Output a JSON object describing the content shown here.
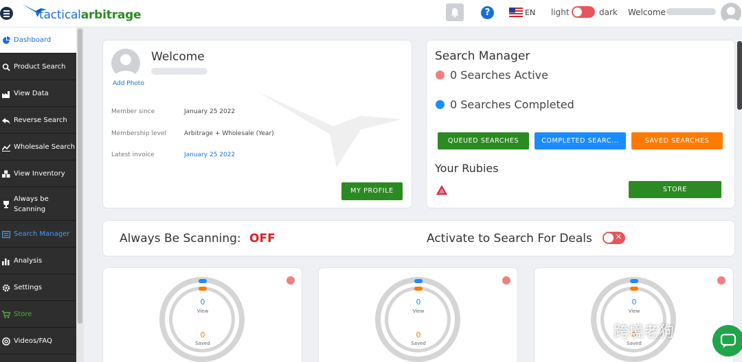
{
  "header": {
    "logo_left": "tactical",
    "logo_right": "arbitrage",
    "language": "EN",
    "theme_light": "light",
    "theme_dark": "dark",
    "welcome": "Welcome"
  },
  "sidebar": {
    "items": [
      {
        "label": "Dashboard"
      },
      {
        "label": "Product Search"
      },
      {
        "label": "View Data"
      },
      {
        "label": "Reverse Search"
      },
      {
        "label": "Wholesale Search"
      },
      {
        "label": "View Inventory"
      },
      {
        "label": "Always be Scanning"
      },
      {
        "label": "Search Manager"
      },
      {
        "label": "Analysis"
      },
      {
        "label": "Settings"
      },
      {
        "label": "Store"
      },
      {
        "label": "Videos/FAQ"
      }
    ]
  },
  "welcome_card": {
    "title": "Welcome",
    "add_photo": "Add Photo",
    "member_since_label": "Member since",
    "member_since_value": "January 25 2022",
    "membership_label": "Membership level",
    "membership_value": "Arbitrage + Wholesale (Year)",
    "invoice_label": "Latest invoice",
    "invoice_value": "January 25 2022",
    "profile_button": "MY PROFILE"
  },
  "search_manager": {
    "title": "Search Manager",
    "active": "0 Searches Active",
    "completed": "0 Searches Completed",
    "queued_button": "QUEUED SEARCHES",
    "completed_button": "COMPLETED SEARC...",
    "saved_button": "SAVED SEARCHES",
    "rubies_title": "Your Rubies",
    "store_button": "STORE"
  },
  "scanning": {
    "label": "Always Be Scanning:",
    "value": "OFF",
    "activate_label": "Activate to Search For Deals",
    "toggle_symbol": "✕"
  },
  "mini_cards": [
    {
      "view_count": "0",
      "view_label": "View",
      "saved_count": "0",
      "saved_label": "Saved"
    },
    {
      "view_count": "0",
      "view_label": "View",
      "saved_count": "0",
      "saved_label": "Saved"
    },
    {
      "view_count": "0",
      "view_label": "View",
      "saved_count": "0",
      "saved_label": "Saved"
    }
  ],
  "watermark_text": "跨境老狗",
  "colors": {
    "primary_blue": "#1a6fd6",
    "brand_green": "#2c8a22",
    "accent_orange": "#ff7a00",
    "alert_red": "#e02020",
    "sidebar_bg": "#2e2e2e"
  },
  "icons": {
    "menu": "hamburger-icon",
    "notifications": "bell-icon",
    "help": "help-icon",
    "language": "us-flag-icon",
    "chat": "chat-icon"
  }
}
